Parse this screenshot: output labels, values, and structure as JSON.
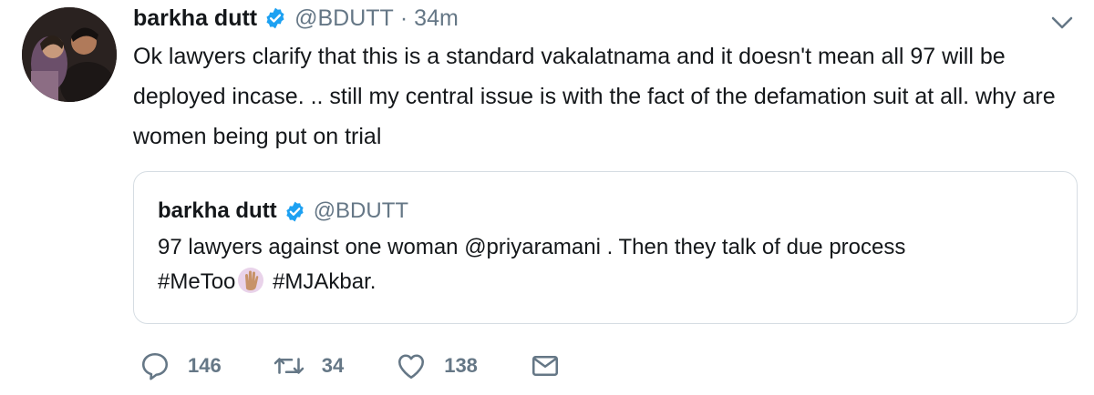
{
  "tweet": {
    "author_name": "barkha dutt",
    "handle": "@BDUTT",
    "separator": "·",
    "time": "34m",
    "text": "Ok lawyers clarify that this is a standard vakalatnama and it doesn't mean all 97 will be deployed incase. .. still my central issue is with the fact of the defamation suit at all. why are women being put on trial"
  },
  "quoted": {
    "author_name": "barkha dutt",
    "handle": "@BDUTT",
    "text_part1": "97 lawyers against one woman @priyaramani . Then they talk of due process",
    "hashtag1": "#MeToo",
    "hashtag2": "#MJAkbar."
  },
  "actions": {
    "replies": "146",
    "retweets": "34",
    "likes": "138"
  },
  "icons": {
    "verified": "verified-badge-icon",
    "caret": "chevron-down-icon",
    "reply": "reply-icon",
    "retweet": "retweet-icon",
    "like": "heart-icon",
    "dm": "envelope-icon",
    "emoji": "raised-hand-emoji"
  },
  "colors": {
    "verified_blue": "#1da1f2",
    "secondary_text": "#657786",
    "text": "#14171a",
    "border": "#d6dde3"
  }
}
